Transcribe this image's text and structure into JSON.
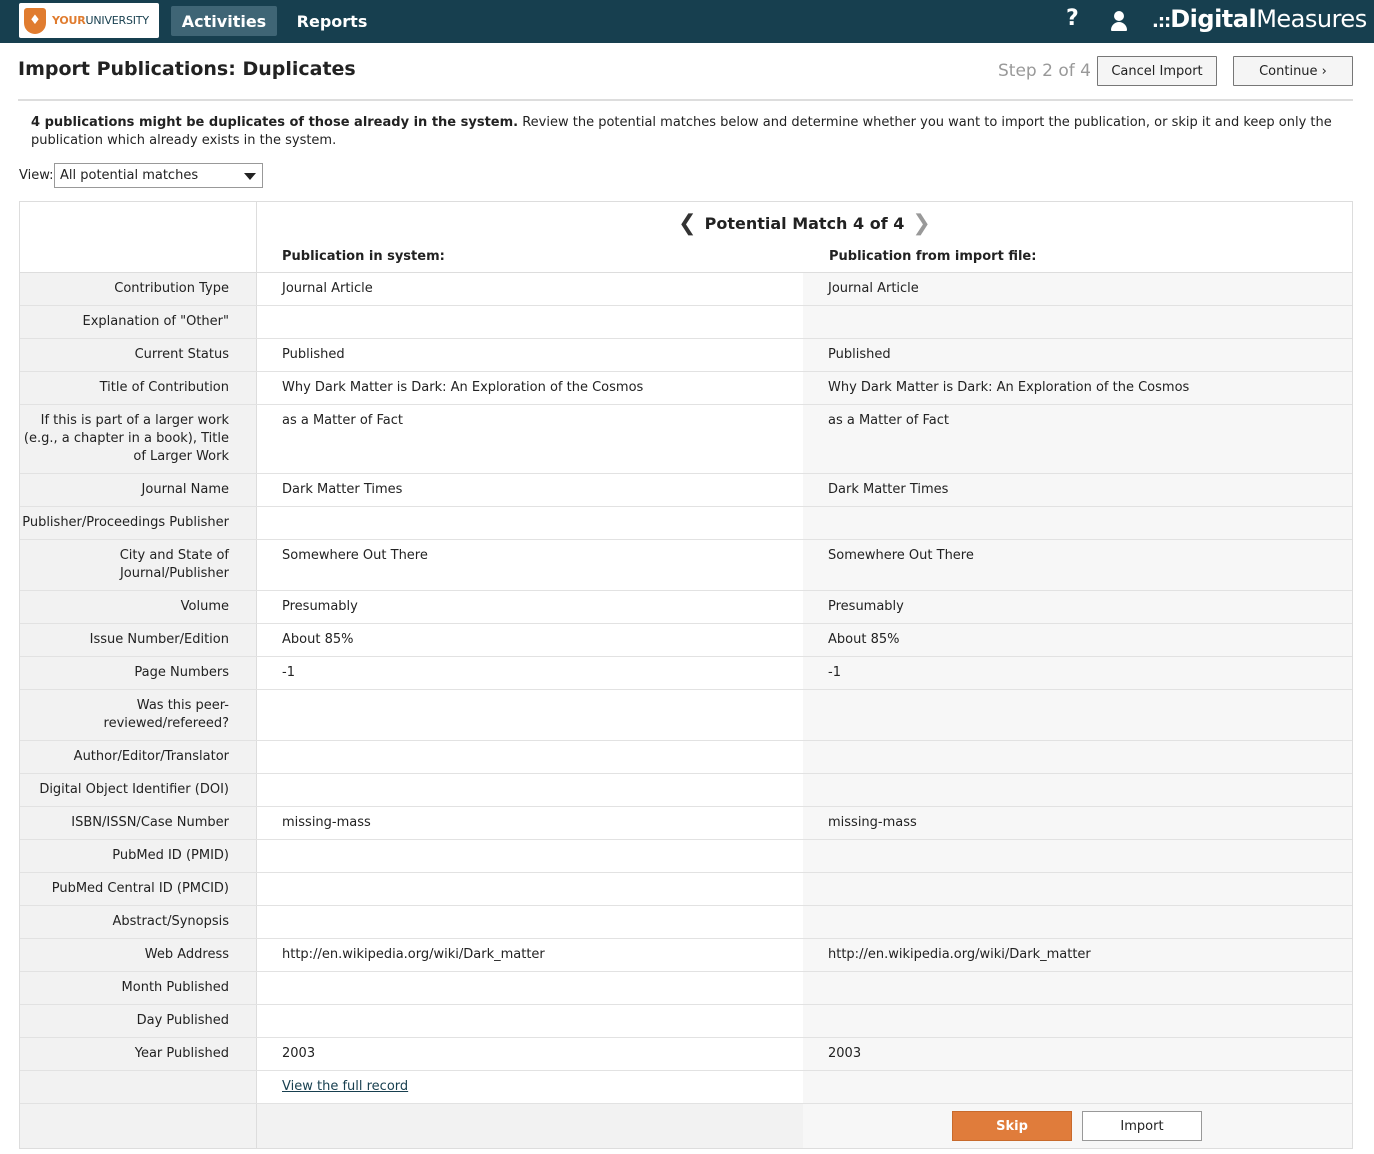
{
  "nav": {
    "logo_your": "YOUR",
    "logo_university": "UNIVERSITY",
    "tabs": [
      "Activities",
      "Reports"
    ],
    "active_tab": "Activities",
    "help_icon": "?",
    "user_icon": "user-icon",
    "brand_dots": ".::",
    "brand_digital": "Digital",
    "brand_measures": "Measures"
  },
  "header": {
    "title": "Import Publications: Duplicates",
    "step": "Step 2 of 4",
    "cancel_label": "Cancel Import",
    "continue_label": "Continue ›"
  },
  "intro": {
    "bold": "4 publications might be duplicates of those already in the system.",
    "text": " Review the potential matches below and determine whether you want to import the publication, or skip it and keep only the publication which already exists in the system."
  },
  "view": {
    "label": "View:",
    "selected": "All potential matches"
  },
  "match": {
    "title": "Potential Match 4 of 4",
    "prev_icon": "chevron-left-icon",
    "next_icon": "chevron-right-icon",
    "col_system": "Publication in system:",
    "col_import": "Publication from import file:"
  },
  "rows": [
    {
      "label": "Contribution Type",
      "system": "Journal Article",
      "import": "Journal Article"
    },
    {
      "label": "Explanation of \"Other\"",
      "system": "",
      "import": ""
    },
    {
      "label": "Current Status",
      "system": "Published",
      "import": "Published"
    },
    {
      "label": "Title of Contribution",
      "system": "Why Dark Matter is Dark: An Exploration of the Cosmos",
      "import": "Why Dark Matter is Dark: An Exploration of the Cosmos"
    },
    {
      "label": "If this is part of a larger work (e.g., a chapter in a book), Title of Larger Work",
      "system": "as a Matter of Fact",
      "import": "as a Matter of Fact"
    },
    {
      "label": "Journal Name",
      "system": "Dark Matter Times",
      "import": "Dark Matter Times"
    },
    {
      "label": "Publisher/Proceedings Publisher",
      "system": "",
      "import": ""
    },
    {
      "label": "City and State of Journal/Publisher",
      "system": "Somewhere Out There",
      "import": "Somewhere Out There"
    },
    {
      "label": "Volume",
      "system": "Presumably",
      "import": "Presumably"
    },
    {
      "label": "Issue Number/Edition",
      "system": "About 85%",
      "import": "About 85%"
    },
    {
      "label": "Page Numbers",
      "system": "-1",
      "import": "-1"
    },
    {
      "label": "Was this peer-reviewed/refereed?",
      "system": "",
      "import": ""
    },
    {
      "label": "Author/Editor/Translator",
      "system": "",
      "import": ""
    },
    {
      "label": "Digital Object Identifier (DOI)",
      "system": "",
      "import": ""
    },
    {
      "label": "ISBN/ISSN/Case Number",
      "system": "missing-mass",
      "import": "missing-mass"
    },
    {
      "label": "PubMed ID (PMID)",
      "system": "",
      "import": ""
    },
    {
      "label": "PubMed Central ID (PMCID)",
      "system": "",
      "import": ""
    },
    {
      "label": "Abstract/Synopsis",
      "system": "",
      "import": ""
    },
    {
      "label": "Web Address",
      "system": "http://en.wikipedia.org/wiki/Dark_matter",
      "import": "http://en.wikipedia.org/wiki/Dark_matter"
    },
    {
      "label": "Month Published",
      "system": "",
      "import": ""
    },
    {
      "label": "Day Published",
      "system": "",
      "import": ""
    },
    {
      "label": "Year Published",
      "system": "2003",
      "import": "2003"
    }
  ],
  "full_record_link": "View the full record",
  "actions": {
    "skip_label": "Skip",
    "import_label": "Import"
  },
  "colors": {
    "nav_bg": "#173f4f",
    "accent_orange": "#e07c3b"
  }
}
